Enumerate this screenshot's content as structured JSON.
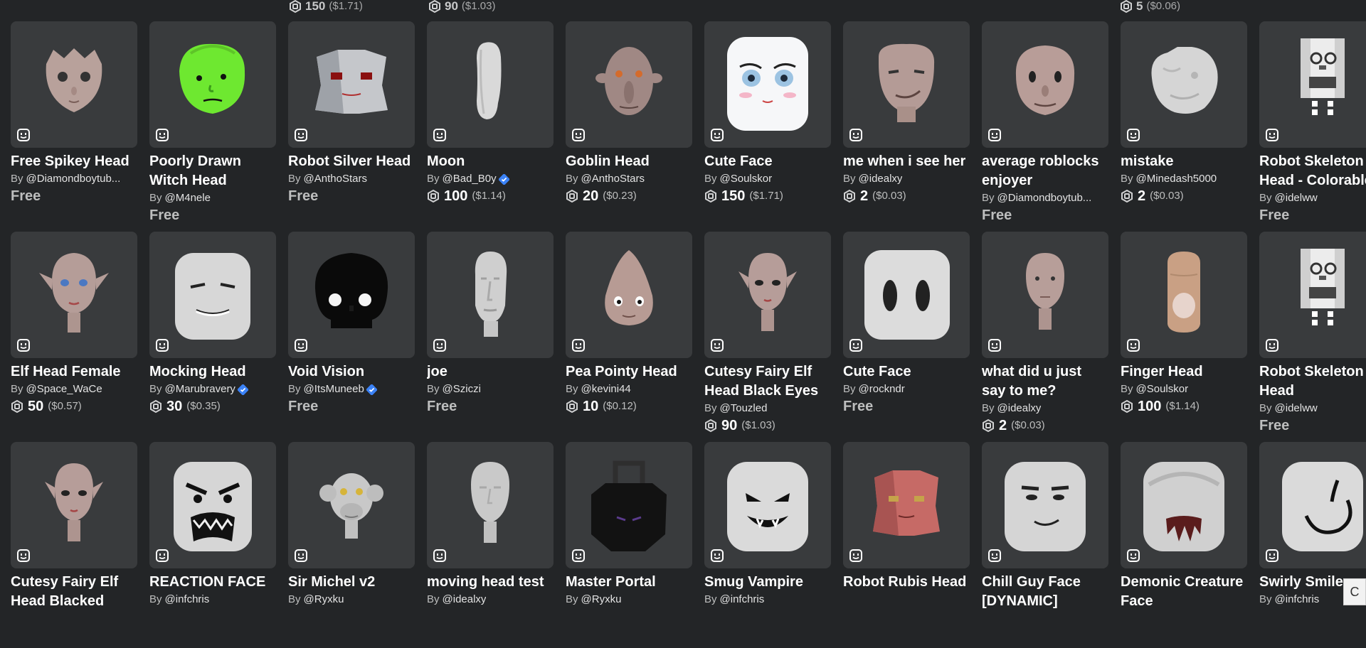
{
  "top_prices": [
    {
      "robux": "150",
      "usd": "($1.71)"
    },
    {
      "robux": "90",
      "usd": "($1.03)"
    },
    {
      "robux": "5",
      "usd": "($0.06)"
    }
  ],
  "rows": [
    [
      {
        "name": "Free Spikey Head",
        "creator": "@Diamondboytub...",
        "free": "Free",
        "art": "spikey"
      },
      {
        "name": "Poorly Drawn Witch Head",
        "creator": "@M4nele",
        "free": "Free",
        "art": "green"
      },
      {
        "name": "Robot Silver Head",
        "creator": "@AnthoStars",
        "free": "Free",
        "art": "robot-silver"
      },
      {
        "name": "Moon",
        "creator": "@Bad_B0y",
        "verified": true,
        "robux": "100",
        "usd": "($1.14)",
        "art": "moon"
      },
      {
        "name": "Goblin Head",
        "creator": "@AnthoStars",
        "robux": "20",
        "usd": "($0.23)",
        "art": "goblin"
      },
      {
        "name": "Cute Face",
        "creator": "@Soulskor",
        "robux": "150",
        "usd": "($1.71)",
        "art": "cute-anime"
      },
      {
        "name": "me when i see her",
        "creator": "@idealxy",
        "robux": "2",
        "usd": "($0.03)",
        "art": "smirk"
      },
      {
        "name": "average roblocks enjoyer",
        "creator": "@Diamondboytub...",
        "free": "Free",
        "art": "enjoyer"
      },
      {
        "name": "mistake",
        "creator": "@Minedash5000",
        "robux": "2",
        "usd": "($0.03)",
        "art": "mistake"
      },
      {
        "name": "Robot Skeleton Head - Colorable",
        "creator": "@idelww",
        "free": "Free",
        "art": "skeleton"
      }
    ],
    [
      {
        "name": "Elf Head Female",
        "creator": "@Space_WaCe",
        "robux": "50",
        "usd": "($0.57)",
        "art": "elf"
      },
      {
        "name": "Mocking Head",
        "creator": "@Marubravery",
        "verified": true,
        "robux": "30",
        "usd": "($0.35)",
        "art": "mocking"
      },
      {
        "name": "Void Vision",
        "creator": "@ItsMuneeb",
        "verified": true,
        "free": "Free",
        "art": "void"
      },
      {
        "name": "joe",
        "creator": "@Sziczi",
        "free": "Free",
        "art": "joe"
      },
      {
        "name": "Pea Pointy Head",
        "creator": "@kevini44",
        "robux": "10",
        "usd": "($0.12)",
        "art": "pointy"
      },
      {
        "name": "Cutesy Fairy Elf Head Black Eyes",
        "creator": "@Touzled",
        "robux": "90",
        "usd": "($1.03)",
        "art": "fairy"
      },
      {
        "name": "Cute Face",
        "creator": "@rockndr",
        "free": "Free",
        "art": "cute-block"
      },
      {
        "name": "what did u just say to me?",
        "creator": "@idealxy",
        "robux": "2",
        "usd": "($0.03)",
        "art": "whatdid"
      },
      {
        "name": "Finger Head",
        "creator": "@Soulskor",
        "robux": "100",
        "usd": "($1.14)",
        "art": "finger"
      },
      {
        "name": "Robot Skeleton Head",
        "creator": "@idelww",
        "free": "Free",
        "art": "skeleton"
      }
    ],
    [
      {
        "name": "Cutesy Fairy Elf Head Blacked",
        "creator": "",
        "art": "fairy2"
      },
      {
        "name": "REACTION FACE",
        "creator": "@infchris",
        "art": "reaction"
      },
      {
        "name": "Sir Michel v2",
        "creator": "@Ryxku",
        "art": "monkey"
      },
      {
        "name": "moving head test",
        "creator": "@idealxy",
        "art": "movinghead"
      },
      {
        "name": "Master Portal",
        "creator": "@Ryxku",
        "art": "portal"
      },
      {
        "name": "Smug Vampire",
        "creator": "@infchris",
        "art": "vampire"
      },
      {
        "name": "Robot Rubis Head",
        "creator": "",
        "art": "robot-rubis"
      },
      {
        "name": "Chill Guy Face [DYNAMIC]",
        "creator": "",
        "art": "chillguy"
      },
      {
        "name": "Demonic Creature Face",
        "creator": "",
        "art": "demonic"
      },
      {
        "name": "Swirly Smile",
        "creator": "@infchris",
        "art": "swirly"
      }
    ]
  ],
  "by_label": "By",
  "colors": {
    "background": "#232527",
    "card": "#393b3d",
    "verified": "#3b82f6"
  },
  "edge_tab_label": "C"
}
